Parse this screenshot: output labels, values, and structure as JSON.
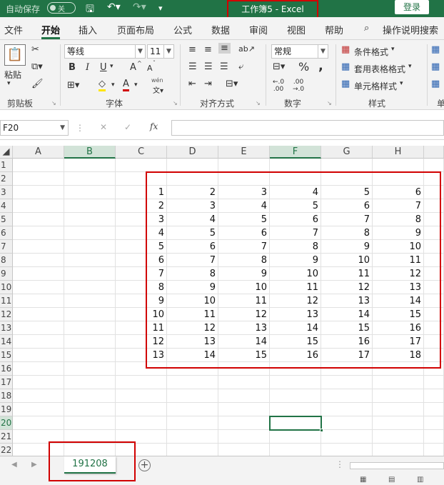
{
  "titlebar": {
    "autosave_label": "自动保存",
    "autosave_state": "关",
    "title": "工作簿5  -  Excel",
    "login": "登录"
  },
  "tabs": [
    "文件",
    "开始",
    "插入",
    "页面布局",
    "公式",
    "数据",
    "审阅",
    "视图",
    "帮助",
    "操作说明搜索"
  ],
  "ribbon": {
    "paste": "粘贴",
    "font_name": "等线",
    "font_size": "11",
    "number_format": "常规",
    "conditional_format": "条件格式",
    "table_format": "套用表格格式",
    "cell_style": "单元格样式",
    "groups": {
      "clipboard": "剪贴板",
      "font": "字体",
      "alignment": "对齐方式",
      "number": "数字",
      "styles": "样式",
      "cells_partial": "单"
    },
    "font_buttons": [
      "B",
      "I",
      "U",
      "A",
      "A",
      "A"
    ],
    "wen": "wén",
    "percent": "%",
    "comma": ","
  },
  "formula_bar": {
    "name_box": "F20",
    "cancel": "✕",
    "confirm": "✓",
    "fx": "fx",
    "content": ""
  },
  "columns": [
    "A",
    "B",
    "C",
    "D",
    "E",
    "F",
    "G",
    "H"
  ],
  "rows": [
    "1",
    "2",
    "3",
    "4",
    "5",
    "6",
    "7",
    "8",
    "9",
    "10",
    "11",
    "12",
    "13",
    "14",
    "15",
    "16",
    "17",
    "18",
    "19",
    "20",
    "21",
    "22"
  ],
  "selected_cell": "F20",
  "selected_column": "B",
  "cell_values": [
    [
      "1",
      "2",
      "3",
      "4",
      "5",
      "6"
    ],
    [
      "2",
      "3",
      "4",
      "5",
      "6",
      "7"
    ],
    [
      "3",
      "4",
      "5",
      "6",
      "7",
      "8"
    ],
    [
      "4",
      "5",
      "6",
      "7",
      "8",
      "9"
    ],
    [
      "5",
      "6",
      "7",
      "8",
      "9",
      "10"
    ],
    [
      "6",
      "7",
      "8",
      "9",
      "10",
      "11"
    ],
    [
      "7",
      "8",
      "9",
      "10",
      "11",
      "12"
    ],
    [
      "8",
      "9",
      "10",
      "11",
      "12",
      "13"
    ],
    [
      "9",
      "10",
      "11",
      "12",
      "13",
      "14"
    ],
    [
      "10",
      "11",
      "12",
      "13",
      "14",
      "15"
    ],
    [
      "11",
      "12",
      "13",
      "14",
      "15",
      "16"
    ],
    [
      "12",
      "13",
      "14",
      "15",
      "16",
      "17"
    ],
    [
      "13",
      "14",
      "15",
      "16",
      "17",
      "18"
    ]
  ],
  "sheet_tab": "191208",
  "colors": {
    "accent": "#217346",
    "highlight_box": "#d10000"
  }
}
